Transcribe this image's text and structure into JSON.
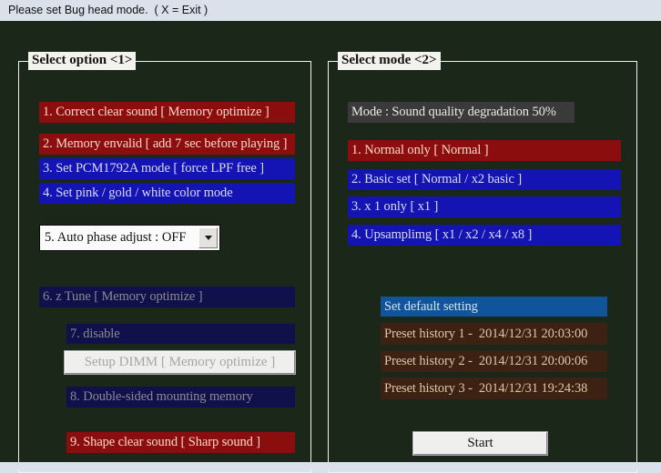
{
  "window": {
    "status_message": "Please set Bug head mode.  ( X = Exit )",
    "colors": {
      "canvas": "#1b2718",
      "chrome": "#dbe1ea",
      "red_bar": "#8b0d0d",
      "blue_bar": "#1414b4",
      "disabled_bar": "#10104a",
      "gray_bar": "#3a3a3a",
      "bright_blue_bar": "#10559c",
      "brown_bar": "#3d2112"
    }
  },
  "left_panel": {
    "legend": "Select option <1>",
    "items": [
      {
        "label": "1. Correct clear sound [ Memory optimize ]"
      },
      {
        "label": "2. Memory envalid [ add 7 sec before playing ]"
      },
      {
        "label": "3. Set PCM1792A mode [ force LPF free ]"
      },
      {
        "label": "4. Set pink / gold / white color mode"
      },
      {
        "label": "6. z Tune [ Memory optimize ]"
      },
      {
        "label": "7. disable"
      },
      {
        "label": "8. Double-sided mounting memory"
      },
      {
        "label": "9. Shape clear sound [ Sharp sound ]"
      }
    ],
    "combo": {
      "value": "5. Auto phase adjust : OFF",
      "arrow_icon": "chevron-down-icon"
    },
    "setup_dimm_button": "Setup DIMM [ Memory optimize ]"
  },
  "right_panel": {
    "legend": "Select mode <2>",
    "mode_label": "Mode : Sound quality degradation 50%",
    "items": [
      {
        "label": "1. Normal only [ Normal ]"
      },
      {
        "label": "2. Basic set [ Normal / x2 basic ]"
      },
      {
        "label": "3. x 1 only [ x1 ]"
      },
      {
        "label": "4. Upsamplimg [ x1 / x2 / x4 / x8 ]"
      }
    ],
    "default_setting": "Set default setting",
    "presets": [
      {
        "label": "Preset history 1 -  2014/12/31 20:03:00"
      },
      {
        "label": "Preset history 2 -  2014/12/31 20:00:06"
      },
      {
        "label": "Preset history 3 -  2014/12/31 19:24:38"
      }
    ],
    "start_button": "Start"
  }
}
